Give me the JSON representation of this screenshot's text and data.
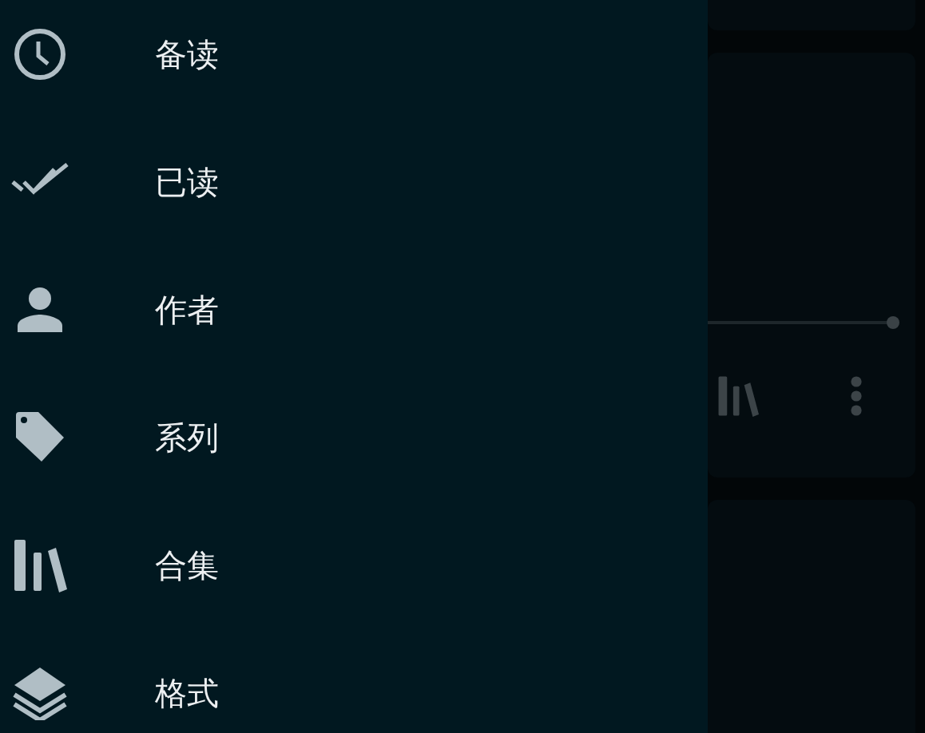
{
  "drawer": {
    "items": [
      {
        "kind": "clock",
        "label": "备读"
      },
      {
        "kind": "double-check",
        "label": "已读"
      },
      {
        "kind": "person",
        "label": "作者"
      },
      {
        "kind": "tag",
        "label": "系列"
      },
      {
        "kind": "books",
        "label": "合集"
      },
      {
        "kind": "layers",
        "label": "格式"
      }
    ]
  },
  "background_card": {
    "progress": {
      "level": 1
    }
  }
}
